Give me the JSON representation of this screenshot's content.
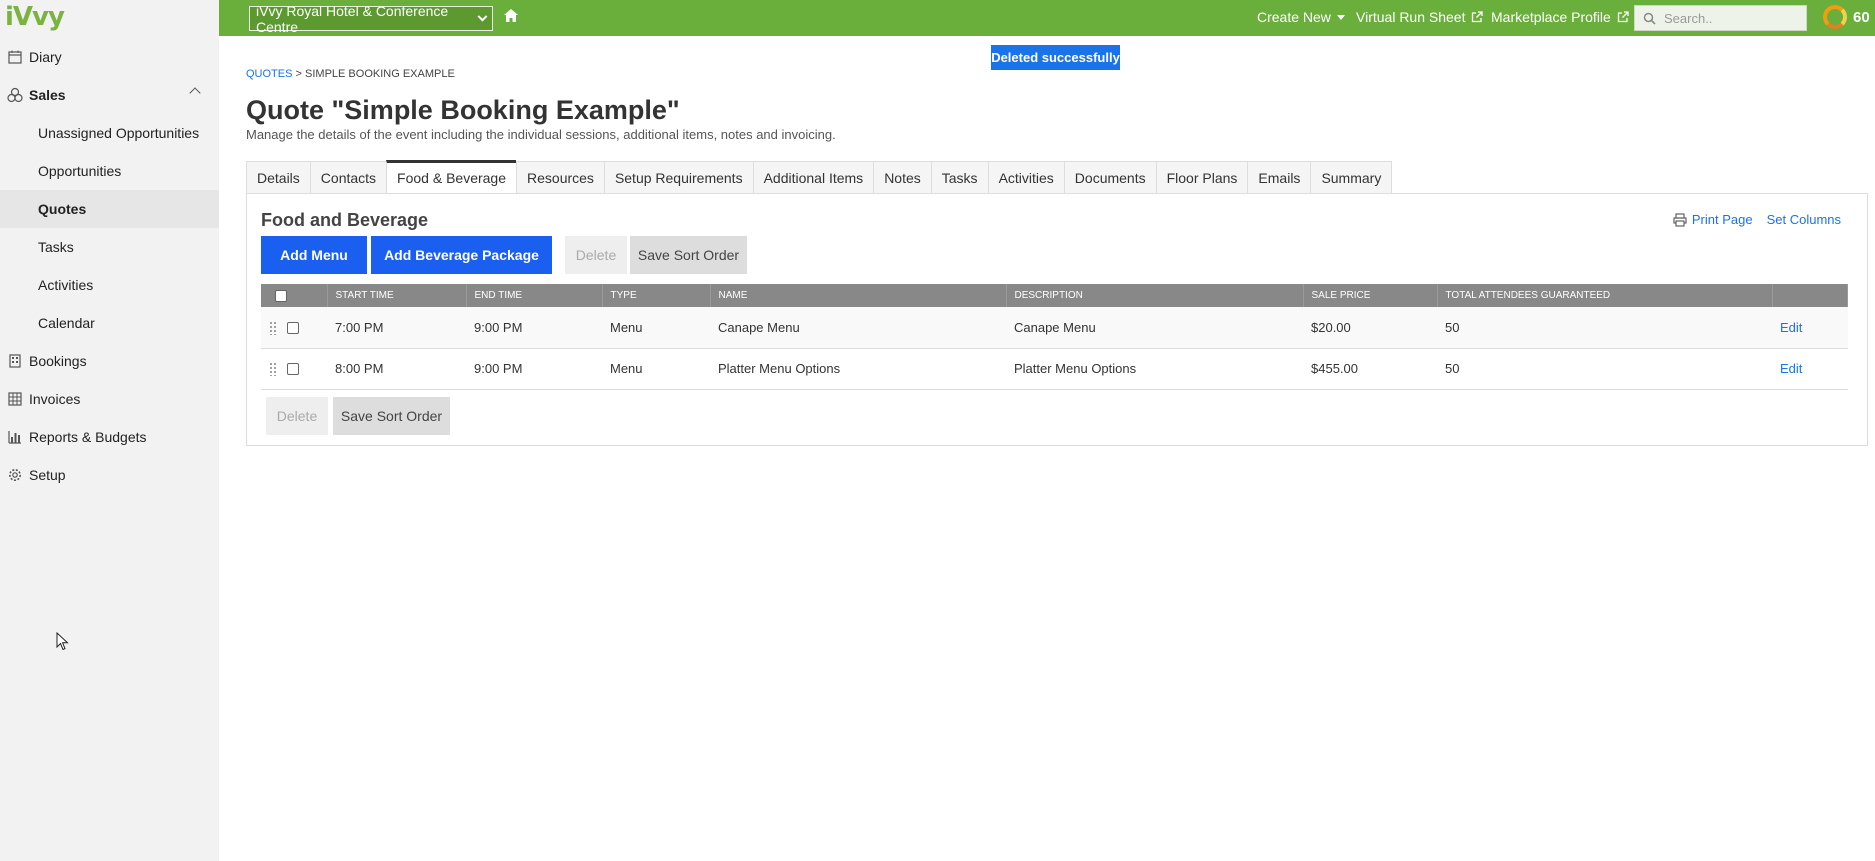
{
  "app": {
    "logo": "iVvy"
  },
  "sidebar": {
    "items": [
      {
        "label": "Diary",
        "icon": "calendar-icon"
      },
      {
        "label": "Sales",
        "icon": "sales-icon"
      },
      {
        "label": "Unassigned Opportunities"
      },
      {
        "label": "Opportunities"
      },
      {
        "label": "Quotes"
      },
      {
        "label": "Tasks"
      },
      {
        "label": "Activities"
      },
      {
        "label": "Calendar"
      },
      {
        "label": "Bookings",
        "icon": "building-icon"
      },
      {
        "label": "Invoices",
        "icon": "invoice-icon"
      },
      {
        "label": "Reports & Budgets",
        "icon": "bar-chart-icon"
      },
      {
        "label": "Setup",
        "icon": "gear-icon"
      }
    ]
  },
  "topbar": {
    "venue": "iVvy Royal Hotel & Conference Centre",
    "create_new": "Create New",
    "virtual_run_sheet": "Virtual Run Sheet",
    "marketplace_profile": "Marketplace Profile",
    "search_placeholder": "Search..",
    "score": "60",
    "accent_color": "#6aae3c"
  },
  "toast": {
    "message": "Deleted successfully"
  },
  "breadcrumb": {
    "parent": "QUOTES",
    "separator": ">",
    "current": "SIMPLE BOOKING EXAMPLE"
  },
  "page": {
    "title": "Quote \"Simple Booking Example\"",
    "subtitle": "Manage the details of the event including the individual sessions, additional items, notes and invoicing."
  },
  "tabs": [
    {
      "label": "Details"
    },
    {
      "label": "Contacts"
    },
    {
      "label": "Food & Beverage",
      "active": true
    },
    {
      "label": "Resources"
    },
    {
      "label": "Setup Requirements"
    },
    {
      "label": "Additional Items"
    },
    {
      "label": "Notes"
    },
    {
      "label": "Tasks"
    },
    {
      "label": "Activities"
    },
    {
      "label": "Documents"
    },
    {
      "label": "Floor Plans"
    },
    {
      "label": "Emails"
    },
    {
      "label": "Summary"
    }
  ],
  "panel": {
    "title": "Food and Beverage",
    "add_menu": "Add Menu",
    "add_beverage_package": "Add Beverage Package",
    "delete": "Delete",
    "save_sort_order": "Save Sort Order",
    "print_page": "Print Page",
    "set_columns": "Set Columns"
  },
  "table": {
    "headers": [
      "START TIME",
      "END TIME",
      "TYPE",
      "NAME",
      "DESCRIPTION",
      "SALE PRICE",
      "TOTAL ATTENDEES GUARANTEED"
    ],
    "rows": [
      {
        "start": "7:00 PM",
        "end": "9:00 PM",
        "type": "Menu",
        "name": "Canape Menu",
        "description": "Canape Menu",
        "price": "$20.00",
        "attendees": "50",
        "action": "Edit"
      },
      {
        "start": "8:00 PM",
        "end": "9:00 PM",
        "type": "Menu",
        "name": "Platter Menu Options",
        "description": "Platter Menu Options",
        "price": "$455.00",
        "attendees": "50",
        "action": "Edit"
      }
    ]
  }
}
